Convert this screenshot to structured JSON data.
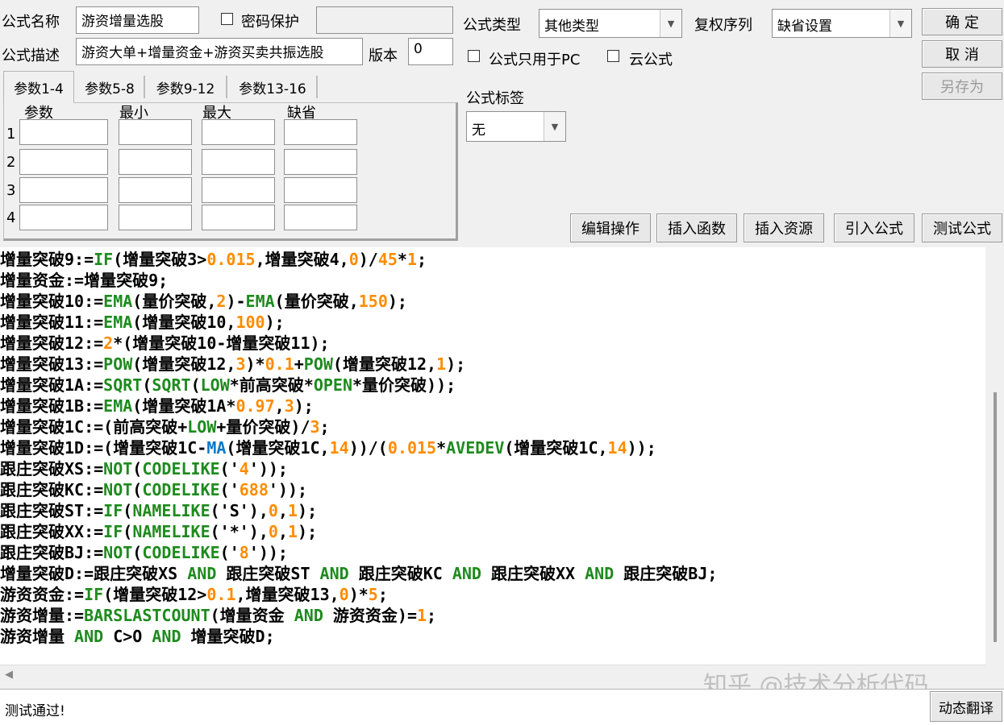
{
  "top": {
    "name_label": "公式名称",
    "name_value": "游资增量选股",
    "password_label": "密码保护",
    "password_value": "",
    "desc_label": "公式描述",
    "desc_value": "游资大单+增量资金+游资买卖共振选股",
    "version_label": "版本",
    "version_value": "0",
    "type_label": "公式类型",
    "type_value": "其他类型",
    "rights_label": "复权序列",
    "rights_value": "缺省设置",
    "pc_only_label": "公式只用于PC",
    "cloud_label": "云公式",
    "tag_label": "公式标签",
    "tag_value": "无"
  },
  "buttons": {
    "ok": "确  定",
    "cancel": "取  消",
    "save_as": "另存为",
    "edit_ops": "编辑操作",
    "insert_func": "插入函数",
    "insert_res": "插入资源",
    "import_formula": "引入公式",
    "test_formula": "测试公式",
    "dynamic_translate": "动态翻译"
  },
  "tabs": [
    "参数1-4",
    "参数5-8",
    "参数9-12",
    "参数13-16"
  ],
  "params": {
    "headers": [
      "参数",
      "最小",
      "最大",
      "缺省"
    ],
    "rows": [
      "1",
      "2",
      "3",
      "4"
    ]
  },
  "code_lines": [
    [
      [
        "t",
        "增量突破9:="
      ],
      [
        "f",
        "IF"
      ],
      [
        "t",
        "(增量突破3>"
      ],
      [
        "n",
        "0.015"
      ],
      [
        "t",
        ",增量突破4,"
      ],
      [
        "n",
        "0"
      ],
      [
        "t",
        ")/"
      ],
      [
        "n",
        "45"
      ],
      [
        "t",
        "*"
      ],
      [
        "n",
        "1"
      ],
      [
        "t",
        ";"
      ]
    ],
    [
      [
        "t",
        "增量资金:=增量突破9;"
      ]
    ],
    [
      [
        "t",
        "增量突破10:="
      ],
      [
        "f",
        "EMA"
      ],
      [
        "t",
        "(量价突破,"
      ],
      [
        "n",
        "2"
      ],
      [
        "t",
        ")-"
      ],
      [
        "f",
        "EMA"
      ],
      [
        "t",
        "(量价突破,"
      ],
      [
        "n",
        "150"
      ],
      [
        "t",
        ");"
      ]
    ],
    [
      [
        "t",
        "增量突破11:="
      ],
      [
        "f",
        "EMA"
      ],
      [
        "t",
        "(增量突破10,"
      ],
      [
        "n",
        "100"
      ],
      [
        "t",
        ");"
      ]
    ],
    [
      [
        "t",
        "增量突破12:="
      ],
      [
        "n",
        "2"
      ],
      [
        "t",
        "*(增量突破10-增量突破11);"
      ]
    ],
    [
      [
        "t",
        "增量突破13:="
      ],
      [
        "f",
        "POW"
      ],
      [
        "t",
        "(增量突破12,"
      ],
      [
        "n",
        "3"
      ],
      [
        "t",
        ")*"
      ],
      [
        "n",
        "0.1"
      ],
      [
        "t",
        "+"
      ],
      [
        "f",
        "POW"
      ],
      [
        "t",
        "(增量突破12,"
      ],
      [
        "n",
        "1"
      ],
      [
        "t",
        ");"
      ]
    ],
    [
      [
        "t",
        "增量突破1A:="
      ],
      [
        "f",
        "SQRT"
      ],
      [
        "t",
        "("
      ],
      [
        "f",
        "SQRT"
      ],
      [
        "t",
        "("
      ],
      [
        "f",
        "LOW"
      ],
      [
        "t",
        "*前高突破*"
      ],
      [
        "f",
        "OPEN"
      ],
      [
        "t",
        "*量价突破));"
      ]
    ],
    [
      [
        "t",
        "增量突破1B:="
      ],
      [
        "f",
        "EMA"
      ],
      [
        "t",
        "(增量突破1A*"
      ],
      [
        "n",
        "0.97"
      ],
      [
        "t",
        ","
      ],
      [
        "n",
        "3"
      ],
      [
        "t",
        ");"
      ]
    ],
    [
      [
        "t",
        "增量突破1C:=(前高突破+"
      ],
      [
        "f",
        "LOW"
      ],
      [
        "t",
        "+量价突破)/"
      ],
      [
        "n",
        "3"
      ],
      [
        "t",
        ";"
      ]
    ],
    [
      [
        "t",
        "增量突破1D:=(增量突破1C-"
      ],
      [
        "m",
        "MA"
      ],
      [
        "t",
        "(增量突破1C,"
      ],
      [
        "n",
        "14"
      ],
      [
        "t",
        "))/("
      ],
      [
        "n",
        "0.015"
      ],
      [
        "t",
        "*"
      ],
      [
        "f",
        "AVEDEV"
      ],
      [
        "t",
        "(增量突破1C,"
      ],
      [
        "n",
        "14"
      ],
      [
        "t",
        "));"
      ]
    ],
    [
      [
        "t",
        "跟庄突破XS:="
      ],
      [
        "f",
        "NOT"
      ],
      [
        "t",
        "("
      ],
      [
        "f",
        "CODELIKE"
      ],
      [
        "t",
        "('"
      ],
      [
        "n",
        "4"
      ],
      [
        "t",
        "'));"
      ]
    ],
    [
      [
        "t",
        "跟庄突破KC:="
      ],
      [
        "f",
        "NOT"
      ],
      [
        "t",
        "("
      ],
      [
        "f",
        "CODELIKE"
      ],
      [
        "t",
        "('"
      ],
      [
        "n",
        "688"
      ],
      [
        "t",
        "'));"
      ]
    ],
    [
      [
        "t",
        "跟庄突破ST:="
      ],
      [
        "f",
        "IF"
      ],
      [
        "t",
        "("
      ],
      [
        "f",
        "NAMELIKE"
      ],
      [
        "t",
        "('S'),"
      ],
      [
        "n",
        "0"
      ],
      [
        "t",
        ","
      ],
      [
        "n",
        "1"
      ],
      [
        "t",
        ");"
      ]
    ],
    [
      [
        "t",
        "跟庄突破XX:="
      ],
      [
        "f",
        "IF"
      ],
      [
        "t",
        "("
      ],
      [
        "f",
        "NAMELIKE"
      ],
      [
        "t",
        "('*'),"
      ],
      [
        "n",
        "0"
      ],
      [
        "t",
        ","
      ],
      [
        "n",
        "1"
      ],
      [
        "t",
        ");"
      ]
    ],
    [
      [
        "t",
        "跟庄突破BJ:="
      ],
      [
        "f",
        "NOT"
      ],
      [
        "t",
        "("
      ],
      [
        "f",
        "CODELIKE"
      ],
      [
        "t",
        "('"
      ],
      [
        "n",
        "8"
      ],
      [
        "t",
        "'));"
      ]
    ],
    [
      [
        "t",
        "增量突破D:=跟庄突破XS "
      ],
      [
        "f",
        "AND"
      ],
      [
        "t",
        " 跟庄突破ST "
      ],
      [
        "f",
        "AND"
      ],
      [
        "t",
        " 跟庄突破KC "
      ],
      [
        "f",
        "AND"
      ],
      [
        "t",
        " 跟庄突破XX "
      ],
      [
        "f",
        "AND"
      ],
      [
        "t",
        " 跟庄突破BJ;"
      ]
    ],
    [
      [
        "t",
        "游资资金:="
      ],
      [
        "f",
        "IF"
      ],
      [
        "t",
        "(增量突破12>"
      ],
      [
        "n",
        "0.1"
      ],
      [
        "t",
        ",增量突破13,"
      ],
      [
        "n",
        "0"
      ],
      [
        "t",
        ")*"
      ],
      [
        "n",
        "5"
      ],
      [
        "t",
        ";"
      ]
    ],
    [
      [
        "t",
        "游资增量:="
      ],
      [
        "f",
        "BARSLASTCOUNT"
      ],
      [
        "t",
        "(增量资金 "
      ],
      [
        "f",
        "AND"
      ],
      [
        "t",
        " 游资资金)="
      ],
      [
        "n",
        "1"
      ],
      [
        "t",
        ";"
      ]
    ],
    [
      [
        "t",
        "游资增量 "
      ],
      [
        "f",
        "AND"
      ],
      [
        "t",
        " C>O "
      ],
      [
        "f",
        "AND"
      ],
      [
        "t",
        " 增量突破D;"
      ]
    ]
  ],
  "status_text": "测试通过!",
  "watermark": "知乎 @技术分析代码"
}
